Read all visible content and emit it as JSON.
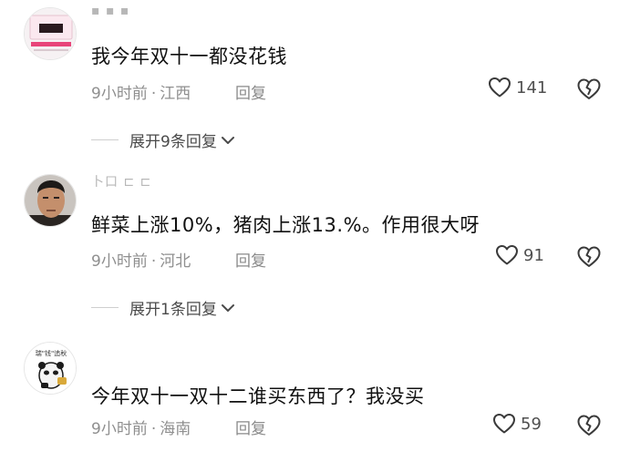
{
  "comments": [
    {
      "username": "▪ ▪ ▪",
      "text": "我今年双十一都没花钱",
      "time": "9小时前",
      "location": "江西",
      "reply_label": "回复",
      "likes": "141",
      "expand_label": "展开9条回复"
    },
    {
      "username": "卜口 ⊏ ⊏",
      "text": "鲜菜上涨10%，猪肉上涨13.%。作用很大呀",
      "time": "9小时前",
      "location": "河北",
      "reply_label": "回复",
      "likes": "91",
      "expand_label": "展开1条回复"
    },
    {
      "avatar_caption": "瑞\"钱\"追秋",
      "text": "今年双十一双十二谁买东西了？我没买",
      "time": "9小时前",
      "location": "海南",
      "reply_label": "回复",
      "likes": "59"
    }
  ],
  "colors": {
    "text": "#111111",
    "meta": "#8f8f8f",
    "icon": "#3a3a3a",
    "accent_pink": "#e8457a"
  },
  "separator": "·"
}
